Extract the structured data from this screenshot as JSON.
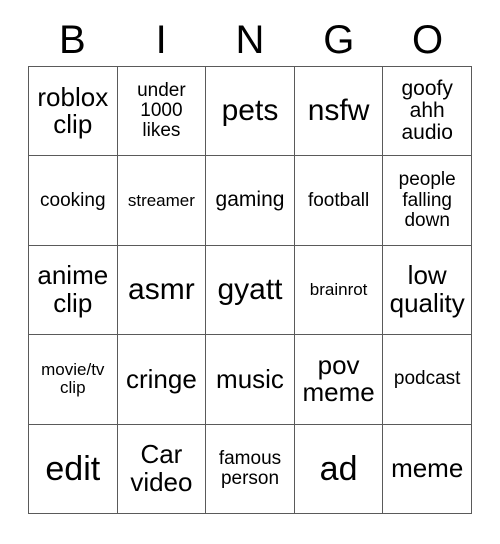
{
  "card": {
    "header_letters": [
      "B",
      "I",
      "N",
      "G",
      "O"
    ],
    "colors": {
      "grid_line": "#5a5a5a",
      "text": "#000000",
      "background": "#ffffff"
    },
    "rows": [
      [
        {
          "label": "roblox clip",
          "size": "sz-md"
        },
        {
          "label": "under 1000 likes",
          "size": "sz-xs"
        },
        {
          "label": "pets",
          "size": "sz-lg"
        },
        {
          "label": "nsfw",
          "size": "sz-lg"
        },
        {
          "label": "goofy ahh audio",
          "size": "sz-sm"
        }
      ],
      [
        {
          "label": "cooking",
          "size": "sz-xs"
        },
        {
          "label": "streamer",
          "size": "sz-xxs"
        },
        {
          "label": "gaming",
          "size": "sz-sm"
        },
        {
          "label": "football",
          "size": "sz-xs"
        },
        {
          "label": "people falling down",
          "size": "sz-xs"
        }
      ],
      [
        {
          "label": "anime clip",
          "size": "sz-md"
        },
        {
          "label": "asmr",
          "size": "sz-lg"
        },
        {
          "label": "gyatt",
          "size": "sz-lg"
        },
        {
          "label": "brainrot",
          "size": "sz-xxs"
        },
        {
          "label": "low quality",
          "size": "sz-md"
        }
      ],
      [
        {
          "label": "movie/tv clip",
          "size": "sz-xxs"
        },
        {
          "label": "cringe",
          "size": "sz-md"
        },
        {
          "label": "music",
          "size": "sz-md"
        },
        {
          "label": "pov meme",
          "size": "sz-md"
        },
        {
          "label": "podcast",
          "size": "sz-xs"
        }
      ],
      [
        {
          "label": "edit",
          "size": "sz-xl"
        },
        {
          "label": "Car video",
          "size": "sz-md"
        },
        {
          "label": "famous person",
          "size": "sz-xs"
        },
        {
          "label": "ad",
          "size": "sz-xl"
        },
        {
          "label": "meme",
          "size": "sz-md"
        }
      ]
    ]
  }
}
